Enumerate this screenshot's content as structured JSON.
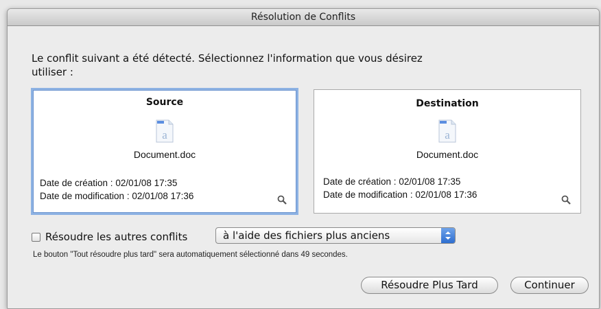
{
  "window": {
    "title": "Résolution de Conflits"
  },
  "message": "Le conflit suivant a été détecté. Sélectionnez l'information que vous désirez utiliser :",
  "source": {
    "title": "Source",
    "filename": "Document.doc",
    "created_label": "Date de création : 02/01/08 17:35",
    "modified_label": "Date de modification : 02/01/08 17:36",
    "icon": "doc-file-icon"
  },
  "destination": {
    "title": "Destination",
    "filename": "Document.doc",
    "created_label": "Date de création : 02/01/08 17:35",
    "modified_label": "Date de modification : 02/01/08 17:36",
    "icon": "doc-file-icon"
  },
  "resolve_option": {
    "checkbox_label": "Résoudre les autres conflits",
    "checked": false,
    "selected_option": "à l'aide des fichiers plus anciens"
  },
  "note": "Le bouton \"Tout résoudre plus tard\" sera automatiquement sélectionné dans 49 secondes.",
  "buttons": {
    "later": "Résoudre Plus Tard",
    "continue": "Continuer"
  },
  "colors": {
    "selected_border": "#8db2e3",
    "popup_arrow": "#2d6ed0"
  }
}
